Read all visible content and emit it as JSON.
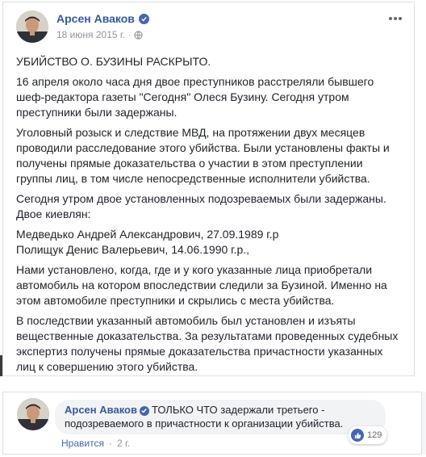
{
  "post": {
    "author": "Арсен Аваков",
    "date": "18 июня 2015 г.",
    "dot": "·",
    "paragraphs": [
      "УБИЙСТВО О. БУЗИНЫ РАСКРЫТО.",
      "16 апреля около часа дня двое преступников расстреляли бывшего шеф-редактора газеты \"Сегодня\" Олеся Бузину. Сегодня утром преступники были задержаны.",
      "Уголовный розыск и следствие МВД, на протяжении двух месяцев проводили расследование этого убийства. Были установлены факты и получены прямые доказательства о участии в этом преступлении группы лиц, в том числе непосредственные исполнители убийства.",
      "Сегодня утром двое установленных подозреваемых были задержаны. Двое киевлян:",
      "Медведько Андрей Александрович, 27.09.1989 г.р\nПолищук Денис Валерьевич, 14.06.1990 г.р.,",
      "Нами установлено, когда, где и у кого указанные лица приобретали автомобиль на котором впоследствии следили за Бузиной. Именно на этом автомобиле преступники и скрылись с места убийства.",
      "В последствии указанный автомобиль был установлен и изъяты вещественные доказательства. За результатами проведенных судебных экспертиз получены прямые доказательства причастности указанных лиц к совершению этого убийства."
    ]
  },
  "comment": {
    "author": "Арсен Аваков",
    "text": "ТОЛЬКО ЧТО задержали третьего - подозреваемого в причастности к организации убийства.",
    "like_label": "Нравится",
    "dot": "·",
    "time": "2 г.",
    "reaction_count": "129"
  },
  "colors": {
    "link": "#365899",
    "meta": "#90949c",
    "accent": "#4267b2",
    "bubble": "#f2f3f5"
  }
}
